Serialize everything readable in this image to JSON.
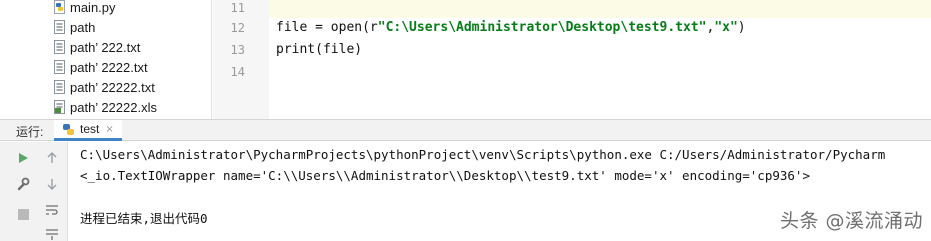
{
  "project_tree": {
    "items": [
      {
        "name": "main.py",
        "icon": "python-file-icon"
      },
      {
        "name": "path",
        "icon": "text-file-icon"
      },
      {
        "name": "path’ 222.txt",
        "icon": "text-file-icon"
      },
      {
        "name": "path’ 2222.txt",
        "icon": "text-file-icon"
      },
      {
        "name": "path’ 22222.txt",
        "icon": "text-file-icon"
      },
      {
        "name": "path’ 22222.xls",
        "icon": "excel-file-icon"
      }
    ]
  },
  "editor": {
    "line_numbers": [
      "11",
      "12",
      "13",
      "14"
    ],
    "code": {
      "line12_prefix": "file = open(r",
      "line12_path": "\"C:\\Users\\Administrator\\Desktop\\test9.txt\"",
      "line12_comma": ",",
      "line12_mode": "\"x\"",
      "line12_suffix": ")",
      "line13": "print(file)"
    }
  },
  "run_panel": {
    "title": "运行:",
    "tab_label": "test",
    "tab_close": "×",
    "console_lines": [
      "C:\\Users\\Administrator\\PycharmProjects\\pythonProject\\venv\\Scripts\\python.exe C:/Users/Administrator/Pycharm",
      "<_io.TextIOWrapper name='C:\\\\Users\\\\Administrator\\\\Desktop\\\\test9.txt' mode='x' encoding='cp936'>",
      "进程已结束,退出代码0"
    ]
  },
  "watermark": "头条 @溪流涌动",
  "colors": {
    "run_accent": "#4083c9",
    "run_green": "#59a869",
    "string_green": "#067d17"
  }
}
